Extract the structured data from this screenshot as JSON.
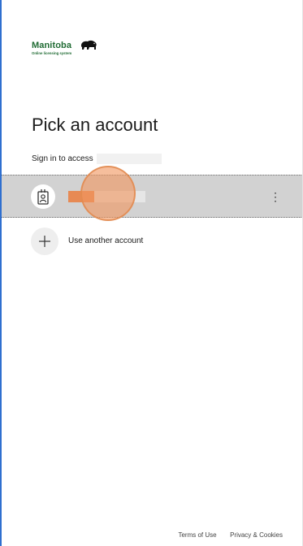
{
  "brand": {
    "name": "Manitoba",
    "tagline": "Online licensing system",
    "color": "#1f6b33",
    "icon": "bison-icon"
  },
  "page": {
    "title": "Pick an account",
    "subtitle": "Sign in to access"
  },
  "accounts": [
    {
      "avatar_icon": "id-badge-icon",
      "menu_glyph": "⋮",
      "selected": true
    }
  ],
  "actions": {
    "use_another": "Use another account",
    "use_another_icon": "plus-icon"
  },
  "footer": {
    "terms": "Terms of Use",
    "privacy": "Privacy & Cookies"
  },
  "colors": {
    "selected_row": "#d2d2d2",
    "frame_border": "#2f6fcf",
    "touch_indicator": "#f0965f"
  }
}
